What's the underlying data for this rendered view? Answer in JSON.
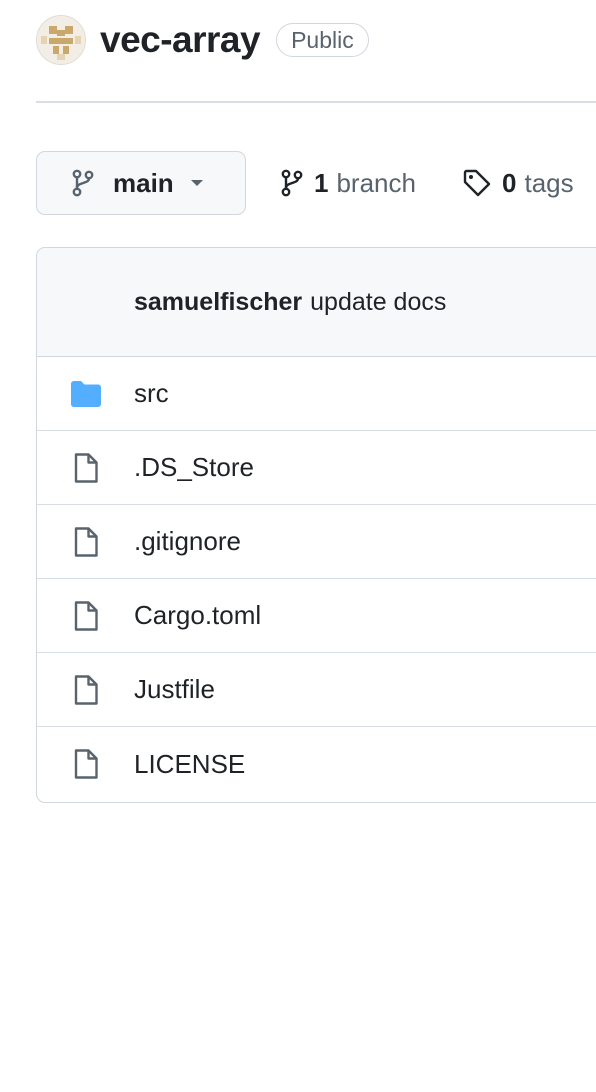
{
  "repo": {
    "name": "vec-array",
    "visibility": "Public"
  },
  "toolbar": {
    "branch_name": "main",
    "branches_count": "1",
    "branches_label": "branch",
    "tags_count": "0",
    "tags_label": "tags"
  },
  "latest_commit": {
    "author": "samuelfischer",
    "message": "update docs"
  },
  "files": [
    {
      "name": "src",
      "type": "directory",
      "icon": "folder-icon"
    },
    {
      "name": ".DS_Store",
      "type": "file",
      "icon": "file-icon"
    },
    {
      "name": ".gitignore",
      "type": "file",
      "icon": "file-icon"
    },
    {
      "name": "Cargo.toml",
      "type": "file",
      "icon": "file-icon"
    },
    {
      "name": "Justfile",
      "type": "file",
      "icon": "file-icon"
    },
    {
      "name": "LICENSE",
      "type": "file",
      "icon": "file-icon"
    }
  ],
  "colors": {
    "folder": "#54aeff",
    "file_icon": "#59636e",
    "border": "#d0d7de",
    "header_bg": "#f6f8fa",
    "avatar_accent": "#c9a86a"
  }
}
